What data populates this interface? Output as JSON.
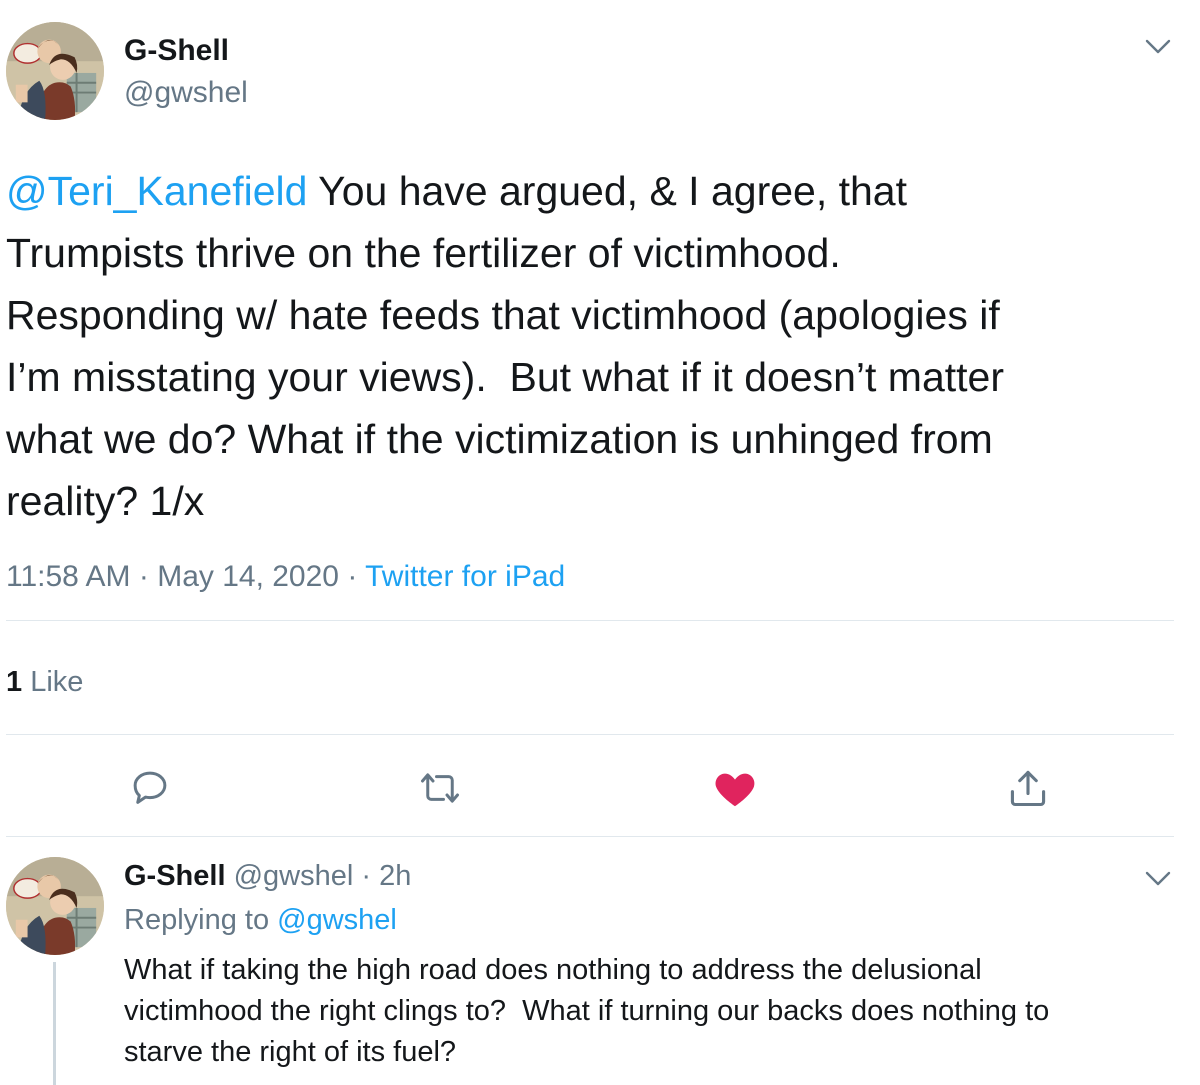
{
  "main_tweet": {
    "display_name": "G-Shell",
    "handle": "@gwshel",
    "mention": "@Teri_Kanefield",
    "body": " You have argued, & I agree, that\nTrumpists thrive on the fertilizer of victimhood.\nResponding w/ hate feeds that victimhood (apologies if\nI’m misstating your views).  But what if it doesn’t matter\nwhat we do? What if the victimization is unhinged from\nreality? 1/x",
    "time": "11:58 AM",
    "separator": " · ",
    "date": "May 14, 2020",
    "source": "Twitter for iPad",
    "like_count": "1",
    "like_label": " Like"
  },
  "reply_tweet": {
    "display_name": "G-Shell",
    "handle": " @gwshel",
    "time_ago": " · 2h",
    "replying_prefix": "Replying to ",
    "replying_to": "@gwshel",
    "body": "What if taking the high road does nothing to address the delusional\nvictimhood the right clings to?  What if turning our backs does nothing to\nstarve the right of its fuel?"
  },
  "icons": {
    "reply": "reply-icon",
    "retweet": "retweet-icon",
    "like": "heart-icon",
    "share": "share-icon",
    "more": "chevron-down-icon"
  },
  "colors": {
    "text": "#14171a",
    "secondary": "#657786",
    "link": "#1da1f2",
    "like_active": "#e0245e",
    "divider": "#e1e8ed"
  }
}
